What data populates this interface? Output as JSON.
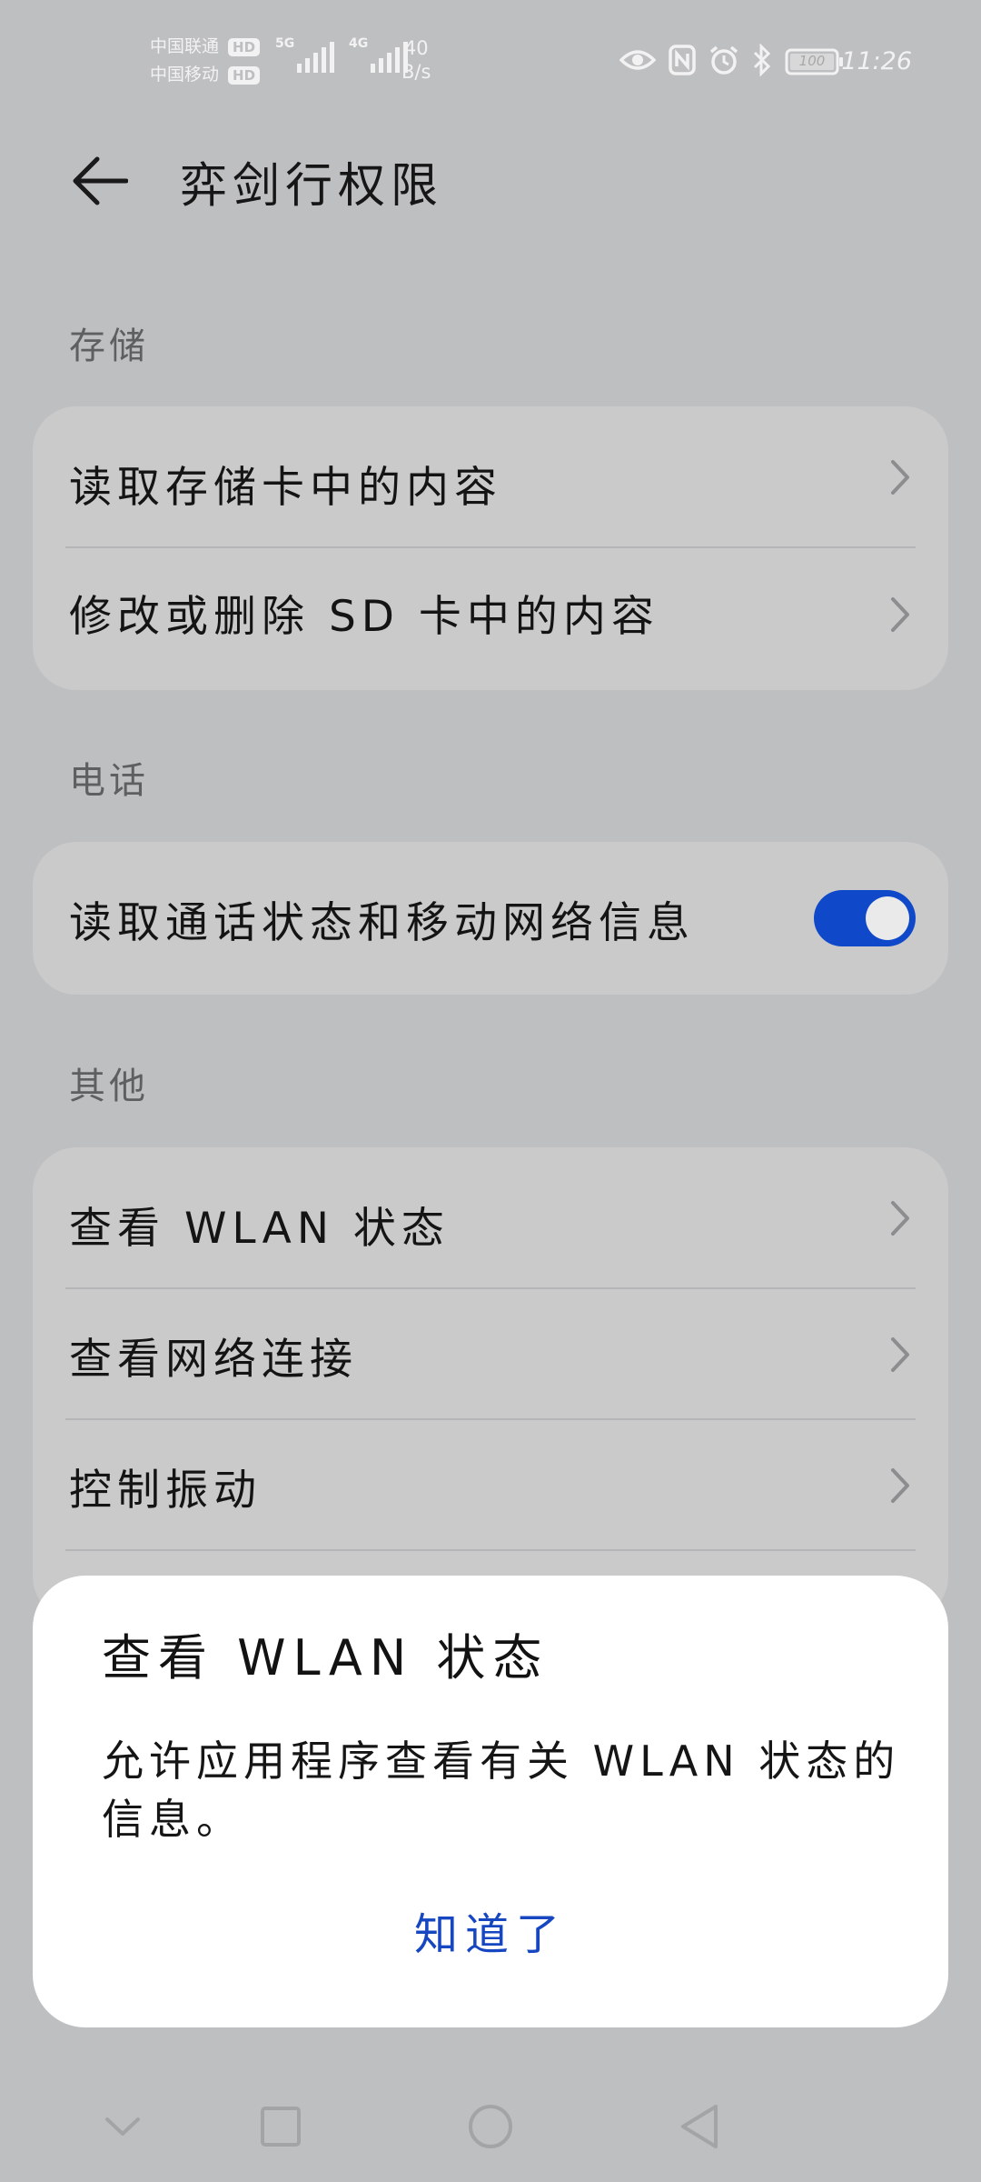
{
  "status_bar": {
    "carrier_1": "中国联通",
    "carrier_2": "中国移动",
    "hd_badge": "HD",
    "network_5g": "5G",
    "network_4g": "4G",
    "speed_value": "40",
    "speed_unit": "B/s",
    "battery": "100",
    "time": "11:26"
  },
  "header": {
    "title": "弈剑行权限"
  },
  "sections": {
    "storage": {
      "label": "存储",
      "items": [
        {
          "label": "读取存储卡中的内容"
        },
        {
          "label": "修改或删除 SD 卡中的内容"
        }
      ]
    },
    "phone": {
      "label": "电话",
      "items": [
        {
          "label": "读取通话状态和移动网络信息",
          "toggle_on": true
        }
      ]
    },
    "other": {
      "label": "其他",
      "items": [
        {
          "label": "查看 WLAN 状态"
        },
        {
          "label": "查看网络连接"
        },
        {
          "label": "控制振动"
        }
      ]
    }
  },
  "dialog": {
    "title": "查看 WLAN 状态",
    "body": "允许应用程序查看有关 WLAN 状态的信息。",
    "button": "知道了"
  },
  "colors": {
    "accent": "#0f49c9",
    "dialog_button": "#1746c1",
    "scrim_background": "#bebfc1"
  },
  "navbar": {
    "icons": [
      "chevron-down-icon",
      "recents-square-icon",
      "home-circle-icon",
      "back-triangle-icon"
    ]
  }
}
